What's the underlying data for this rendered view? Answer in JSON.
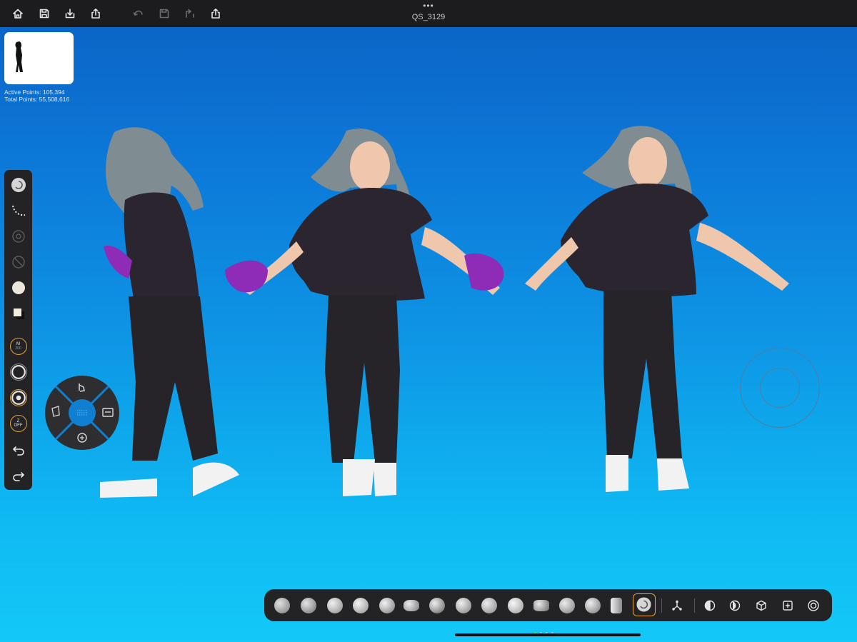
{
  "app": {
    "title": "QS_3129",
    "more_indicator": "•••"
  },
  "topbar": {
    "left_icons": [
      "home-icon",
      "save-icon",
      "import-icon",
      "share-icon"
    ],
    "center_icons": [
      "undo-icon",
      "save-version-icon",
      "redo-icon",
      "export-icon"
    ]
  },
  "stats": {
    "active_points": "Active Points: 105,394",
    "total_points": "Total Points: 55,508,616"
  },
  "left_toolbar": {
    "mask_label": "M",
    "mask_sub": "200",
    "z_label": "Z",
    "z_state": "OFF"
  },
  "bottom_toolbar": {
    "brushes": [
      "clay",
      "clay-buildup",
      "standard",
      "move",
      "inflate",
      "crease",
      "pinch",
      "smooth",
      "flatten",
      "polish",
      "trim",
      "planar",
      "layer",
      "snakehook",
      "spiral"
    ],
    "selected_brush": "spiral",
    "tools": [
      "gizmo-icon",
      "material-icon",
      "mask-icon",
      "cube-icon",
      "frame-icon",
      "xray-icon"
    ]
  },
  "colors": {
    "accent": "#e8a236",
    "bar_bg": "#232325",
    "topbar_bg": "#1c1c1e"
  }
}
